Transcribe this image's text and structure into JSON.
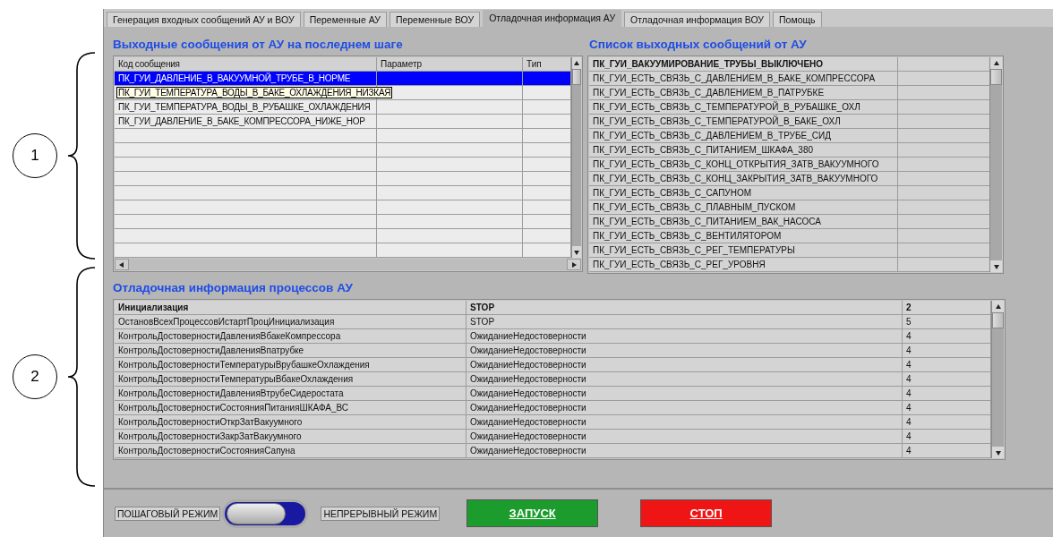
{
  "callouts": [
    "1",
    "2"
  ],
  "tabs": [
    {
      "label": "Генерация входных сообщений АУ и ВОУ",
      "selected": false
    },
    {
      "label": "Переменные АУ",
      "selected": false
    },
    {
      "label": "Переменные ВОУ",
      "selected": false
    },
    {
      "label": "Отладочная информация АУ",
      "selected": true
    },
    {
      "label": "Отладочная информация ВОУ",
      "selected": false
    },
    {
      "label": "Помощь",
      "selected": false
    }
  ],
  "last_step": {
    "title": "Выходные сообщения от АУ на последнем шаге",
    "columns": [
      "Код сообщения",
      "Параметр",
      "Тип"
    ],
    "rows": [
      {
        "code": "ПК_ГУИ_ДАВЛЕНИЕ_В_ВАКУУМНОЙ_ТРУБЕ_В_НОРМЕ",
        "selected": true,
        "tooltip": false
      },
      {
        "code": "ПК_ГУИ_ТЕМПЕРАТУРА_ВОДЫ_В_БАКЕ_ОХЛАЖДЕНИЯ_НИЗКАЯ",
        "selected": false,
        "tooltip": true
      },
      {
        "code": "ПК_ГУИ_ТЕМПЕРАТУРА_ВОДЫ_В_РУБАШКЕ_ОХЛАЖДЕНИЯ",
        "selected": false,
        "tooltip": false
      },
      {
        "code": "ПК_ГУИ_ДАВЛЕНИЕ_В_БАКЕ_КОМПРЕССОРА_НИЖЕ_НОР",
        "selected": false,
        "tooltip": false
      }
    ]
  },
  "messages": {
    "title": "Список выходных сообщений от АУ",
    "rows": [
      {
        "text": "ПК_ГУИ_ВАКУУМИРОВАНИЕ_ТРУБЫ_ВЫКЛЮЧЕНО",
        "bold": true
      },
      {
        "text": "ПК_ГУИ_ЕСТЬ_СВЯЗЬ_С_ДАВЛЕНИЕМ_В_БАКЕ_КОМПРЕССОРА",
        "bold": false
      },
      {
        "text": "ПК_ГУИ_ЕСТЬ_СВЯЗЬ_С_ДАВЛЕНИЕМ_В_ПАТРУБКЕ",
        "bold": false
      },
      {
        "text": "ПК_ГУИ_ЕСТЬ_СВЯЗЬ_С_ТЕМПЕРАТУРОЙ_В_РУБАШКЕ_ОХЛ",
        "bold": false
      },
      {
        "text": "ПК_ГУИ_ЕСТЬ_СВЯЗЬ_С_ТЕМПЕРАТУРОЙ_В_БАКЕ_ОХЛ",
        "bold": false
      },
      {
        "text": "ПК_ГУИ_ЕСТЬ_СВЯЗЬ_С_ДАВЛЕНИЕМ_В_ТРУБЕ_СИД",
        "bold": false
      },
      {
        "text": "ПК_ГУИ_ЕСТЬ_СВЯЗЬ_С_ПИТАНИЕМ_ШКАФА_380",
        "bold": false
      },
      {
        "text": "ПК_ГУИ_ЕСТЬ_СВЯЗЬ_С_КОНЦ_ОТКРЫТИЯ_ЗАТВ_ВАКУУМНОГО",
        "bold": false
      },
      {
        "text": "ПК_ГУИ_ЕСТЬ_СВЯЗЬ_С_КОНЦ_ЗАКРЫТИЯ_ЗАТВ_ВАКУУМНОГО",
        "bold": false
      },
      {
        "text": "ПК_ГУИ_ЕСТЬ_СВЯЗЬ_С_САПУНОМ",
        "bold": false
      },
      {
        "text": "ПК_ГУИ_ЕСТЬ_СВЯЗЬ_С_ПЛАВНЫМ_ПУСКОМ",
        "bold": false
      },
      {
        "text": "ПК_ГУИ_ЕСТЬ_СВЯЗЬ_С_ПИТАНИЕМ_ВАК_НАСОСА",
        "bold": false
      },
      {
        "text": "ПК_ГУИ_ЕСТЬ_СВЯЗЬ_С_ВЕНТИЛЯТОРОМ",
        "bold": false
      },
      {
        "text": "ПК_ГУИ_ЕСТЬ_СВЯЗЬ_С_РЕГ_ТЕМПЕРАТУРЫ",
        "bold": false
      },
      {
        "text": "ПК_ГУИ_ЕСТЬ_СВЯЗЬ_С_РЕГ_УРОВНЯ",
        "bold": false
      }
    ]
  },
  "processes": {
    "title": "Отладочная информация процессов АУ",
    "rows": [
      {
        "process": "Инициализация",
        "state": "STOP",
        "value": "2",
        "bold": true
      },
      {
        "process": "ОстановВсехПроцессовИстартПроцИнициализация",
        "state": "STOP",
        "value": "5",
        "bold": false
      },
      {
        "process": "КонтрольДостоверностиДавленияВбакеКомпрессора",
        "state": "ОжиданиеНедостоверности",
        "value": "4",
        "bold": false
      },
      {
        "process": "КонтрольДостоверностиДавленияВпатрубке",
        "state": "ОжиданиеНедостоверности",
        "value": "4",
        "bold": false
      },
      {
        "process": "КонтрольДостоверностиТемпературыВрубашкеОхлаждения",
        "state": "ОжиданиеНедостоверности",
        "value": "4",
        "bold": false
      },
      {
        "process": "КонтрольДостоверностиТемпературыВбакеОхлаждения",
        "state": "ОжиданиеНедостоверности",
        "value": "4",
        "bold": false
      },
      {
        "process": "КонтрольДостоверностиДавленияВтрубеСидеростата",
        "state": "ОжиданиеНедостоверности",
        "value": "4",
        "bold": false
      },
      {
        "process": "КонтрольДостоверностиСостоянияПитанияШКАФА_ВС",
        "state": "ОжиданиеНедостоверности",
        "value": "4",
        "bold": false
      },
      {
        "process": "КонтрольДостоверностиОткрЗатВакуумного",
        "state": "ОжиданиеНедостоверности",
        "value": "4",
        "bold": false
      },
      {
        "process": "КонтрольДостоверностиЗакрЗатВакуумного",
        "state": "ОжиданиеНедостоверности",
        "value": "4",
        "bold": false
      },
      {
        "process": "КонтрольДостоверностиСостоянияСапуна",
        "state": "ОжиданиеНедостоверности",
        "value": "4",
        "bold": false
      }
    ]
  },
  "mode": {
    "left_label": "ПОШАГОВЫЙ РЕЖИМ",
    "right_label": "НЕПРЕРЫВНЫЙ РЕЖИМ",
    "on": false
  },
  "buttons": [
    {
      "label": "ЗАПУСК",
      "kind": "start"
    },
    {
      "label": "СТОП",
      "kind": "stop"
    }
  ]
}
